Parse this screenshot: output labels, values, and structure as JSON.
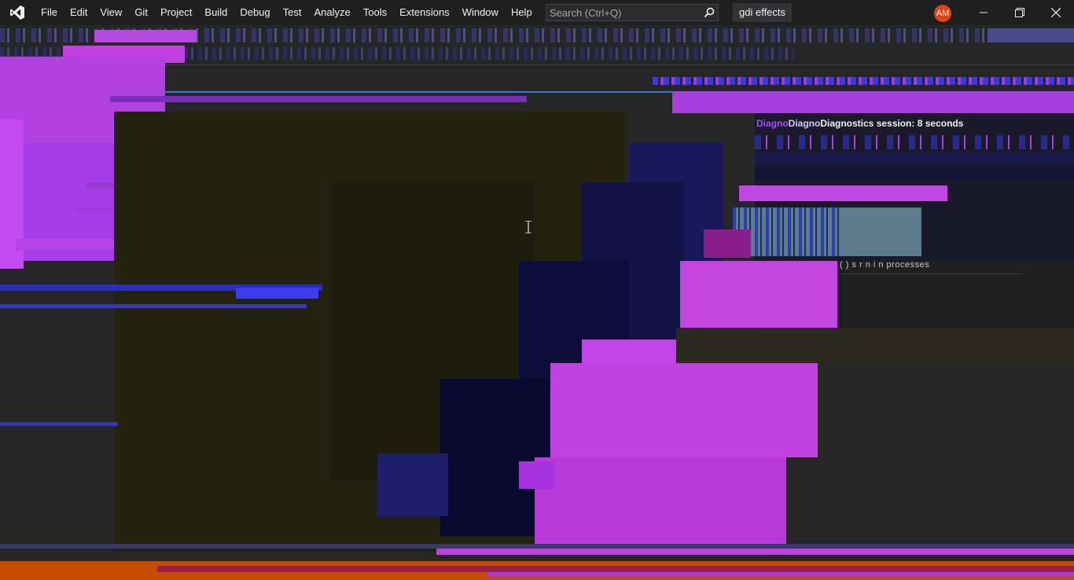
{
  "app": {
    "logo_icon": "visual-studio-logo-icon"
  },
  "menu": {
    "items": [
      "File",
      "Edit",
      "View",
      "Git",
      "Project",
      "Build",
      "Debug",
      "Test",
      "Analyze",
      "Tools",
      "Extensions",
      "Window",
      "Help"
    ]
  },
  "search": {
    "placeholder": "Search (Ctrl+Q)",
    "icon": "search-icon"
  },
  "solution": {
    "name": "gdi effects"
  },
  "user": {
    "initials": "AM"
  },
  "window_controls": {
    "minimize_icon": "minimize-icon",
    "restore_icon": "restore-icon",
    "close_icon": "close-icon"
  },
  "diagnostics": {
    "ghost_a": "Diagno",
    "ghost_b": "Diagno",
    "title": "Diagnostics session: 8 seconds",
    "sublabel": "( ) s r n i  n  processes"
  },
  "colors": {
    "accent": "#a64dff",
    "magenta": "#c644e6",
    "navy": "#0d0d3a",
    "status": "#c44d00",
    "titlebar": "#1f1f1f"
  }
}
